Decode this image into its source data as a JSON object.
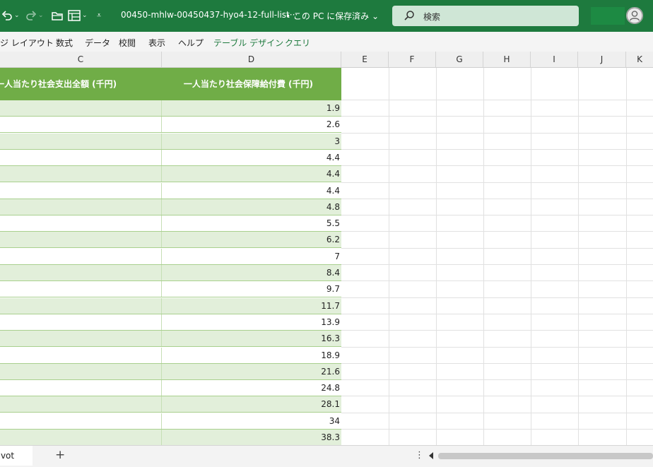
{
  "titlebar": {
    "filename": "00450-mhlw-00450437-hyo4-12-full-list···",
    "save_state": "• この PC に保存済み ⌄",
    "search_label": "検索"
  },
  "ribbon": {
    "tabs": [
      "ジ レイアウト",
      "数式",
      "データ",
      "校閲",
      "表示",
      "ヘルプ",
      "テーブル デザイン",
      "クエリ"
    ]
  },
  "columns": [
    "C",
    "D",
    "E",
    "F",
    "G",
    "H",
    "I",
    "J",
    "K"
  ],
  "table": {
    "header_c": "一人当たり社会支出全額 (千円)",
    "header_d": "一人当たり社会保障給付費 (千円)",
    "values_d": [
      "1.9",
      "2.6",
      "3",
      "4.4",
      "4.4",
      "4.4",
      "4.8",
      "5.5",
      "6.2",
      "7",
      "8.4",
      "9.7",
      "11.7",
      "13.9",
      "16.3",
      "18.9",
      "21.6",
      "24.8",
      "28.1",
      "34",
      "38.3"
    ]
  },
  "sheetbar": {
    "tab": "pivot",
    "add": "+",
    "more": "⋮"
  },
  "colors": {
    "titlebar": "#1e7a3e",
    "table_header": "#70ad47",
    "band": "#e2efda"
  }
}
